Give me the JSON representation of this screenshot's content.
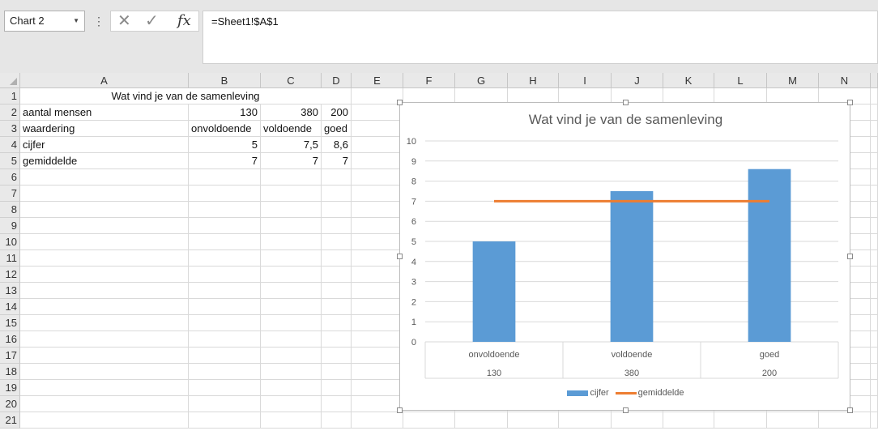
{
  "namebox": {
    "value": "Chart 2"
  },
  "formula_bar": {
    "value": "=Sheet1!$A$1",
    "more_icon": "vertical-dots-icon",
    "cancel_icon": "x-icon",
    "enter_icon": "check-icon",
    "fx_label": "fx"
  },
  "columns": [
    "A",
    "B",
    "C",
    "D",
    "E",
    "F",
    "G",
    "H",
    "I",
    "J",
    "K",
    "L",
    "M",
    "N"
  ],
  "rows": [
    "1",
    "2",
    "3",
    "4",
    "5",
    "6",
    "7",
    "8",
    "9",
    "10",
    "11",
    "12",
    "13",
    "14",
    "15",
    "16",
    "17",
    "18",
    "19",
    "20",
    "21"
  ],
  "cells": {
    "A1": "Wat vind je van de samenleving",
    "A2": "aantal mensen",
    "B2": "130",
    "C2": "380",
    "D2": "200",
    "A3": "waardering",
    "B3": "onvoldoende",
    "C3": "voldoende",
    "D3": "goed",
    "A4": "cijfer",
    "B4": "5",
    "C4": "7,5",
    "D4": "8,6",
    "A5": "gemiddelde",
    "B5": "7",
    "C5": "7",
    "D5": "7"
  },
  "chart_data": {
    "type": "bar",
    "title": "Wat vind je van de samenleving",
    "categories": [
      "onvoldoende",
      "voldoende",
      "goed"
    ],
    "secondary_categories": [
      "130",
      "380",
      "200"
    ],
    "series": [
      {
        "name": "cijfer",
        "type": "bar",
        "values": [
          5,
          7.5,
          8.6
        ],
        "color": "#5b9bd5"
      },
      {
        "name": "gemiddelde",
        "type": "line",
        "values": [
          7,
          7,
          7
        ],
        "color": "#ed7d31"
      }
    ],
    "ylim": [
      0,
      10
    ],
    "yticks": [
      "0",
      "1",
      "2",
      "3",
      "4",
      "5",
      "6",
      "7",
      "8",
      "9",
      "10"
    ],
    "grid": true,
    "legend": "bottom"
  }
}
